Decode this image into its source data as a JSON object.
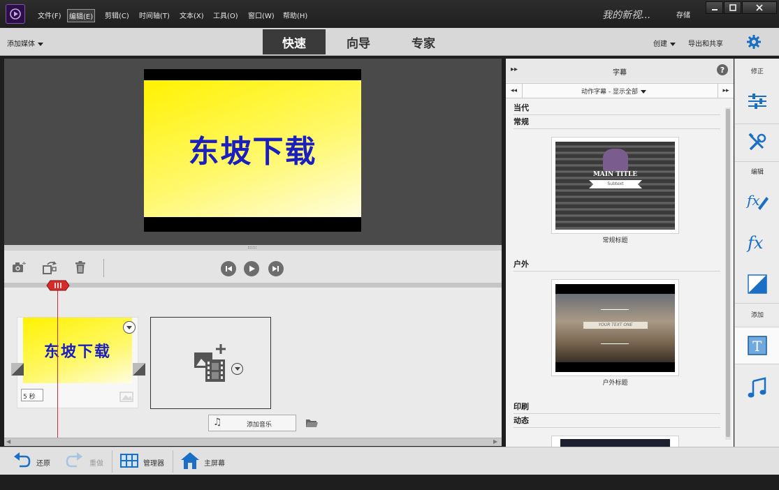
{
  "titlebar": {
    "menus": [
      "文件(F)",
      "编辑(E)",
      "剪辑(C)",
      "时间轴(T)",
      "文本(X)",
      "工具(O)",
      "窗口(W)",
      "帮助(H)"
    ],
    "project_name": "我的新视...",
    "save_label": "存储"
  },
  "modebar": {
    "add_media": "添加媒体",
    "tabs": [
      "快速",
      "向导",
      "专家"
    ],
    "active_tab": "快速",
    "create": "创建",
    "export_share": "导出和共享"
  },
  "monitor": {
    "preview_text": "东坡下载"
  },
  "timeline": {
    "clip_text": "东坡下载",
    "clip_duration": "5 秒",
    "add_music": "添加音乐"
  },
  "bottombar": {
    "undo": "还原",
    "redo": "重做",
    "organizer": "管理器",
    "home": "主屏幕"
  },
  "panel": {
    "title": "字幕",
    "filter_label": "动作字幕 - 显示全部",
    "sections": [
      "当代",
      "常规",
      "户外",
      "印刷",
      "动态"
    ],
    "thumb1_caption": "常规标题",
    "thumb1_main": "MAIN TITLE",
    "thumb1_sub": "Subtext",
    "thumb2_caption": "户外标题",
    "thumb2_main": "YOUR TEXT ONE"
  },
  "strip": {
    "adjust_label": "修正",
    "edit_label": "编辑",
    "add_label": "添加"
  },
  "colors": {
    "accent": "#1a6fc4",
    "playhead": "#d42b2b",
    "preview_text": "#1a1fbd"
  }
}
